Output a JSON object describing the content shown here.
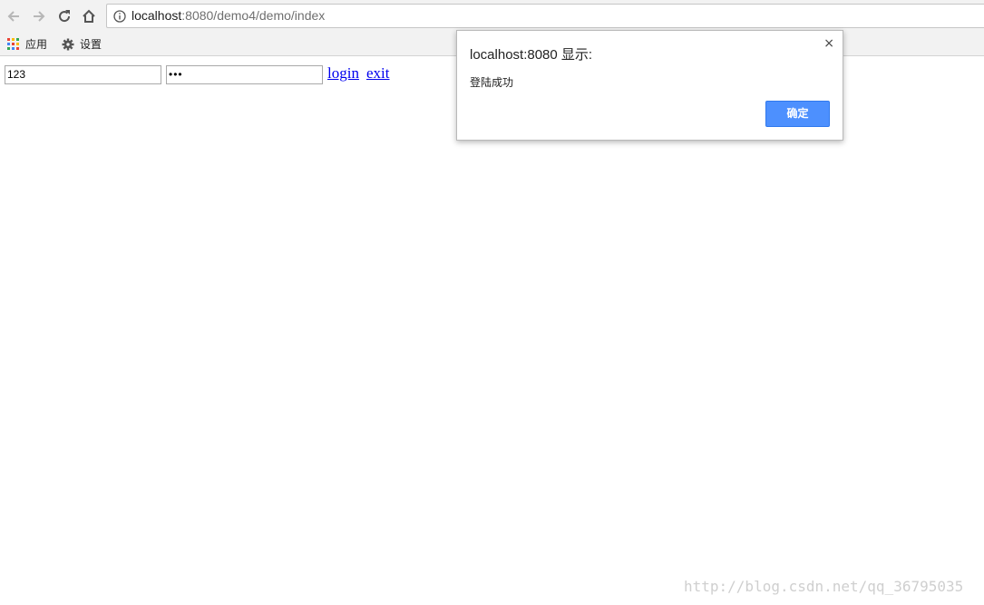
{
  "browser": {
    "url_host": "localhost",
    "url_rest": ":8080/demo4/demo/index",
    "icons": [
      "back-arrow-icon",
      "forward-arrow-icon",
      "reload-icon",
      "home-icon",
      "info-icon"
    ]
  },
  "bookmarks": {
    "items": [
      {
        "label": "应用",
        "icon": "apps-grid-icon"
      },
      {
        "label": "设置",
        "icon": "gear-icon"
      }
    ]
  },
  "form": {
    "username_value": "123",
    "password_value": "•••",
    "login_label": "login",
    "exit_label": "exit"
  },
  "dialog": {
    "title": "localhost:8080 显示:",
    "close_glyph": "×",
    "message": "登陆成功",
    "ok_label": "确定",
    "accent": "#4d90fe"
  },
  "watermark": "http://blog.csdn.net/qq_36795035"
}
